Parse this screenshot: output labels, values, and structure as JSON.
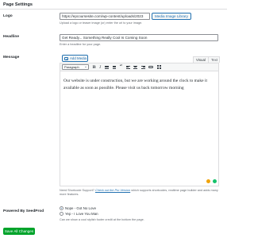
{
  "page": {
    "section_title": "Page Settings"
  },
  "logo": {
    "label": "Logo",
    "input_value": "https://epcoursesite.com/wp-content/uploads/2023",
    "button_label": "Media Image Library",
    "description": "Upload a logo or teaser image (or) enter the url to your image."
  },
  "headline": {
    "label": "Headline",
    "input_value": "Get Ready... Something Really Cool Is Coming Soon",
    "description": "Enter a headline for your page."
  },
  "message": {
    "label": "Message",
    "add_media_label": "Add Media",
    "tab_visual": "Visual",
    "tab_text": "Text",
    "format_select": "Paragraph",
    "toolbar": {
      "bold": "B",
      "italic": "I",
      "quote": "“"
    },
    "body": "Our website is under construction, but we are working around the clock to make it available as soon as possible. Please visit us back tomorrow morning",
    "note_prefix": "Need Shortcode Support?",
    "note_link": "Check out the Pro Version",
    "note_suffix": "which supports shortcodes, realtime page builder and adds many more features."
  },
  "powered_by": {
    "label": "Powered By SeedProd",
    "options": [
      {
        "label": "Nope - Got No Love",
        "selected": true
      },
      {
        "label": "Yep - I Love You Man",
        "selected": false
      }
    ],
    "description": "Can we show a cool stylish footer credit at the bottom the page."
  },
  "footer": {
    "save_label": "Save All Changes"
  },
  "colors": {
    "accent": "#2271b1",
    "save": "#00a32a"
  }
}
